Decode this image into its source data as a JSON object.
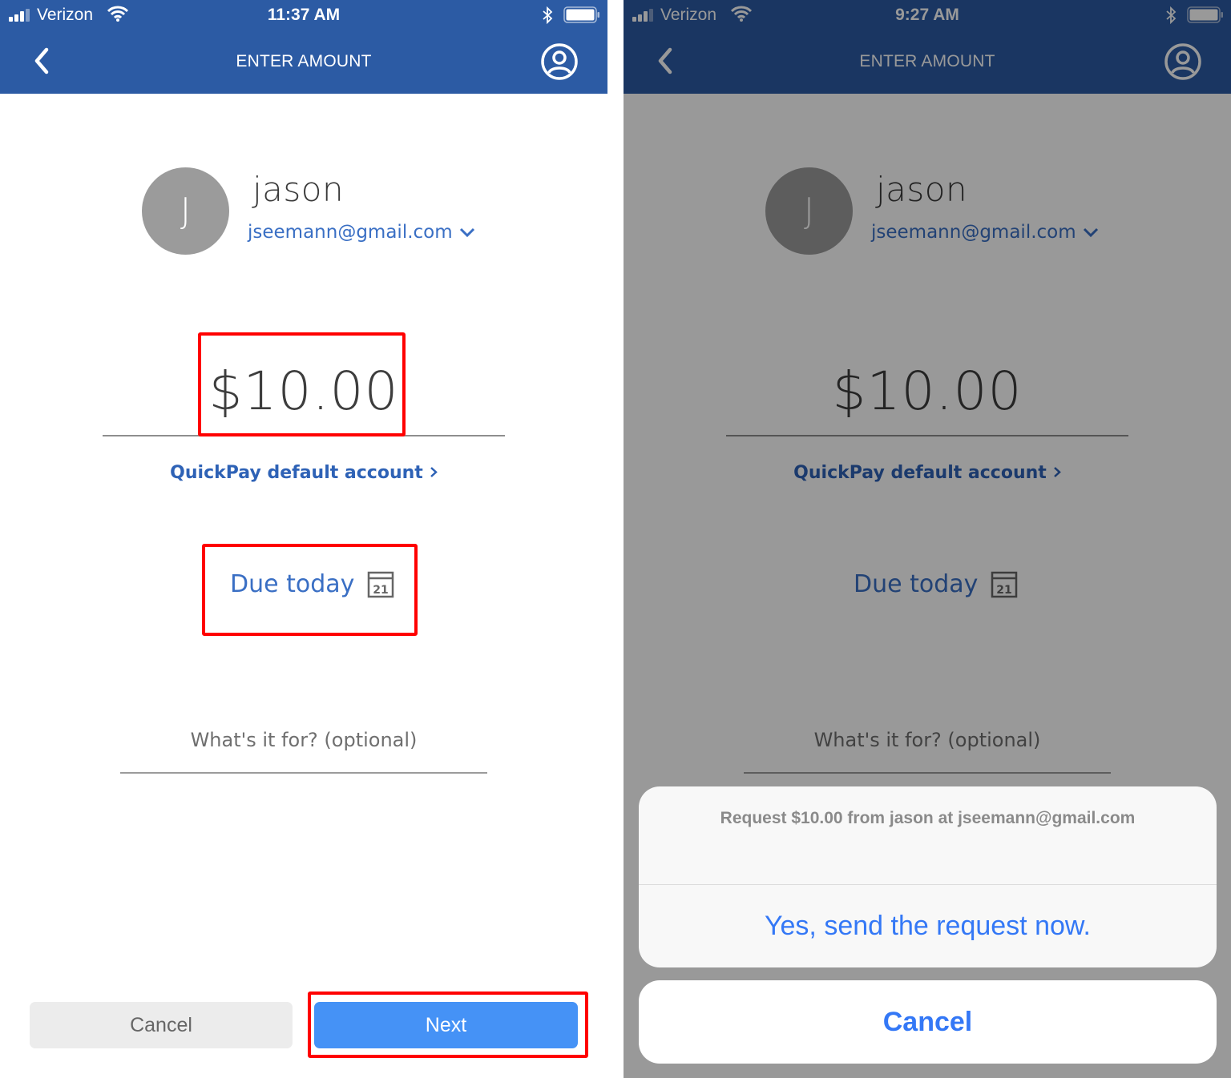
{
  "colors": {
    "nav_bar": "#2c5ba4",
    "link_blue": "#3a6fc4",
    "primary_button": "#4592f6",
    "secondary_button": "#ececec",
    "annotation_red": "#ff0000",
    "ios_action_blue": "#3478f6"
  },
  "left": {
    "status_bar": {
      "carrier": "Verizon",
      "time": "11:37 AM",
      "icons": [
        "signal-icon",
        "wifi-icon",
        "bluetooth-icon",
        "battery-icon"
      ]
    },
    "nav": {
      "back_icon": "chevron-left-icon",
      "title": "ENTER AMOUNT",
      "profile_icon": "profile-icon"
    },
    "payee": {
      "initial": "J",
      "name": "jason",
      "email": "jseemann@gmail.com",
      "email_dropdown_icon": "chevron-down-icon"
    },
    "amount": "$10.00",
    "account_link": "QuickPay default account",
    "due_date": {
      "label": "Due today",
      "calendar_day": "21"
    },
    "memo_placeholder": "What's it for? (optional)",
    "buttons": {
      "cancel": "Cancel",
      "next": "Next"
    },
    "annotations": [
      "amount",
      "due-date",
      "next-button"
    ]
  },
  "right": {
    "status_bar": {
      "carrier": "Verizon",
      "time": "9:27 AM",
      "icons": [
        "signal-icon",
        "wifi-icon",
        "bluetooth-icon",
        "battery-icon"
      ]
    },
    "nav": {
      "back_icon": "chevron-left-icon",
      "title": "ENTER AMOUNT",
      "profile_icon": "profile-icon"
    },
    "payee": {
      "initial": "J",
      "name": "jason",
      "email": "jseemann@gmail.com"
    },
    "amount": "$10.00",
    "account_link": "QuickPay default account",
    "due_date": {
      "label": "Due today",
      "calendar_day": "21"
    },
    "memo_placeholder": "What's it for? (optional)",
    "action_sheet": {
      "message": "Request $10.00 from jason at jseemann@gmail.com",
      "confirm": "Yes, send the request now.",
      "cancel": "Cancel"
    }
  }
}
